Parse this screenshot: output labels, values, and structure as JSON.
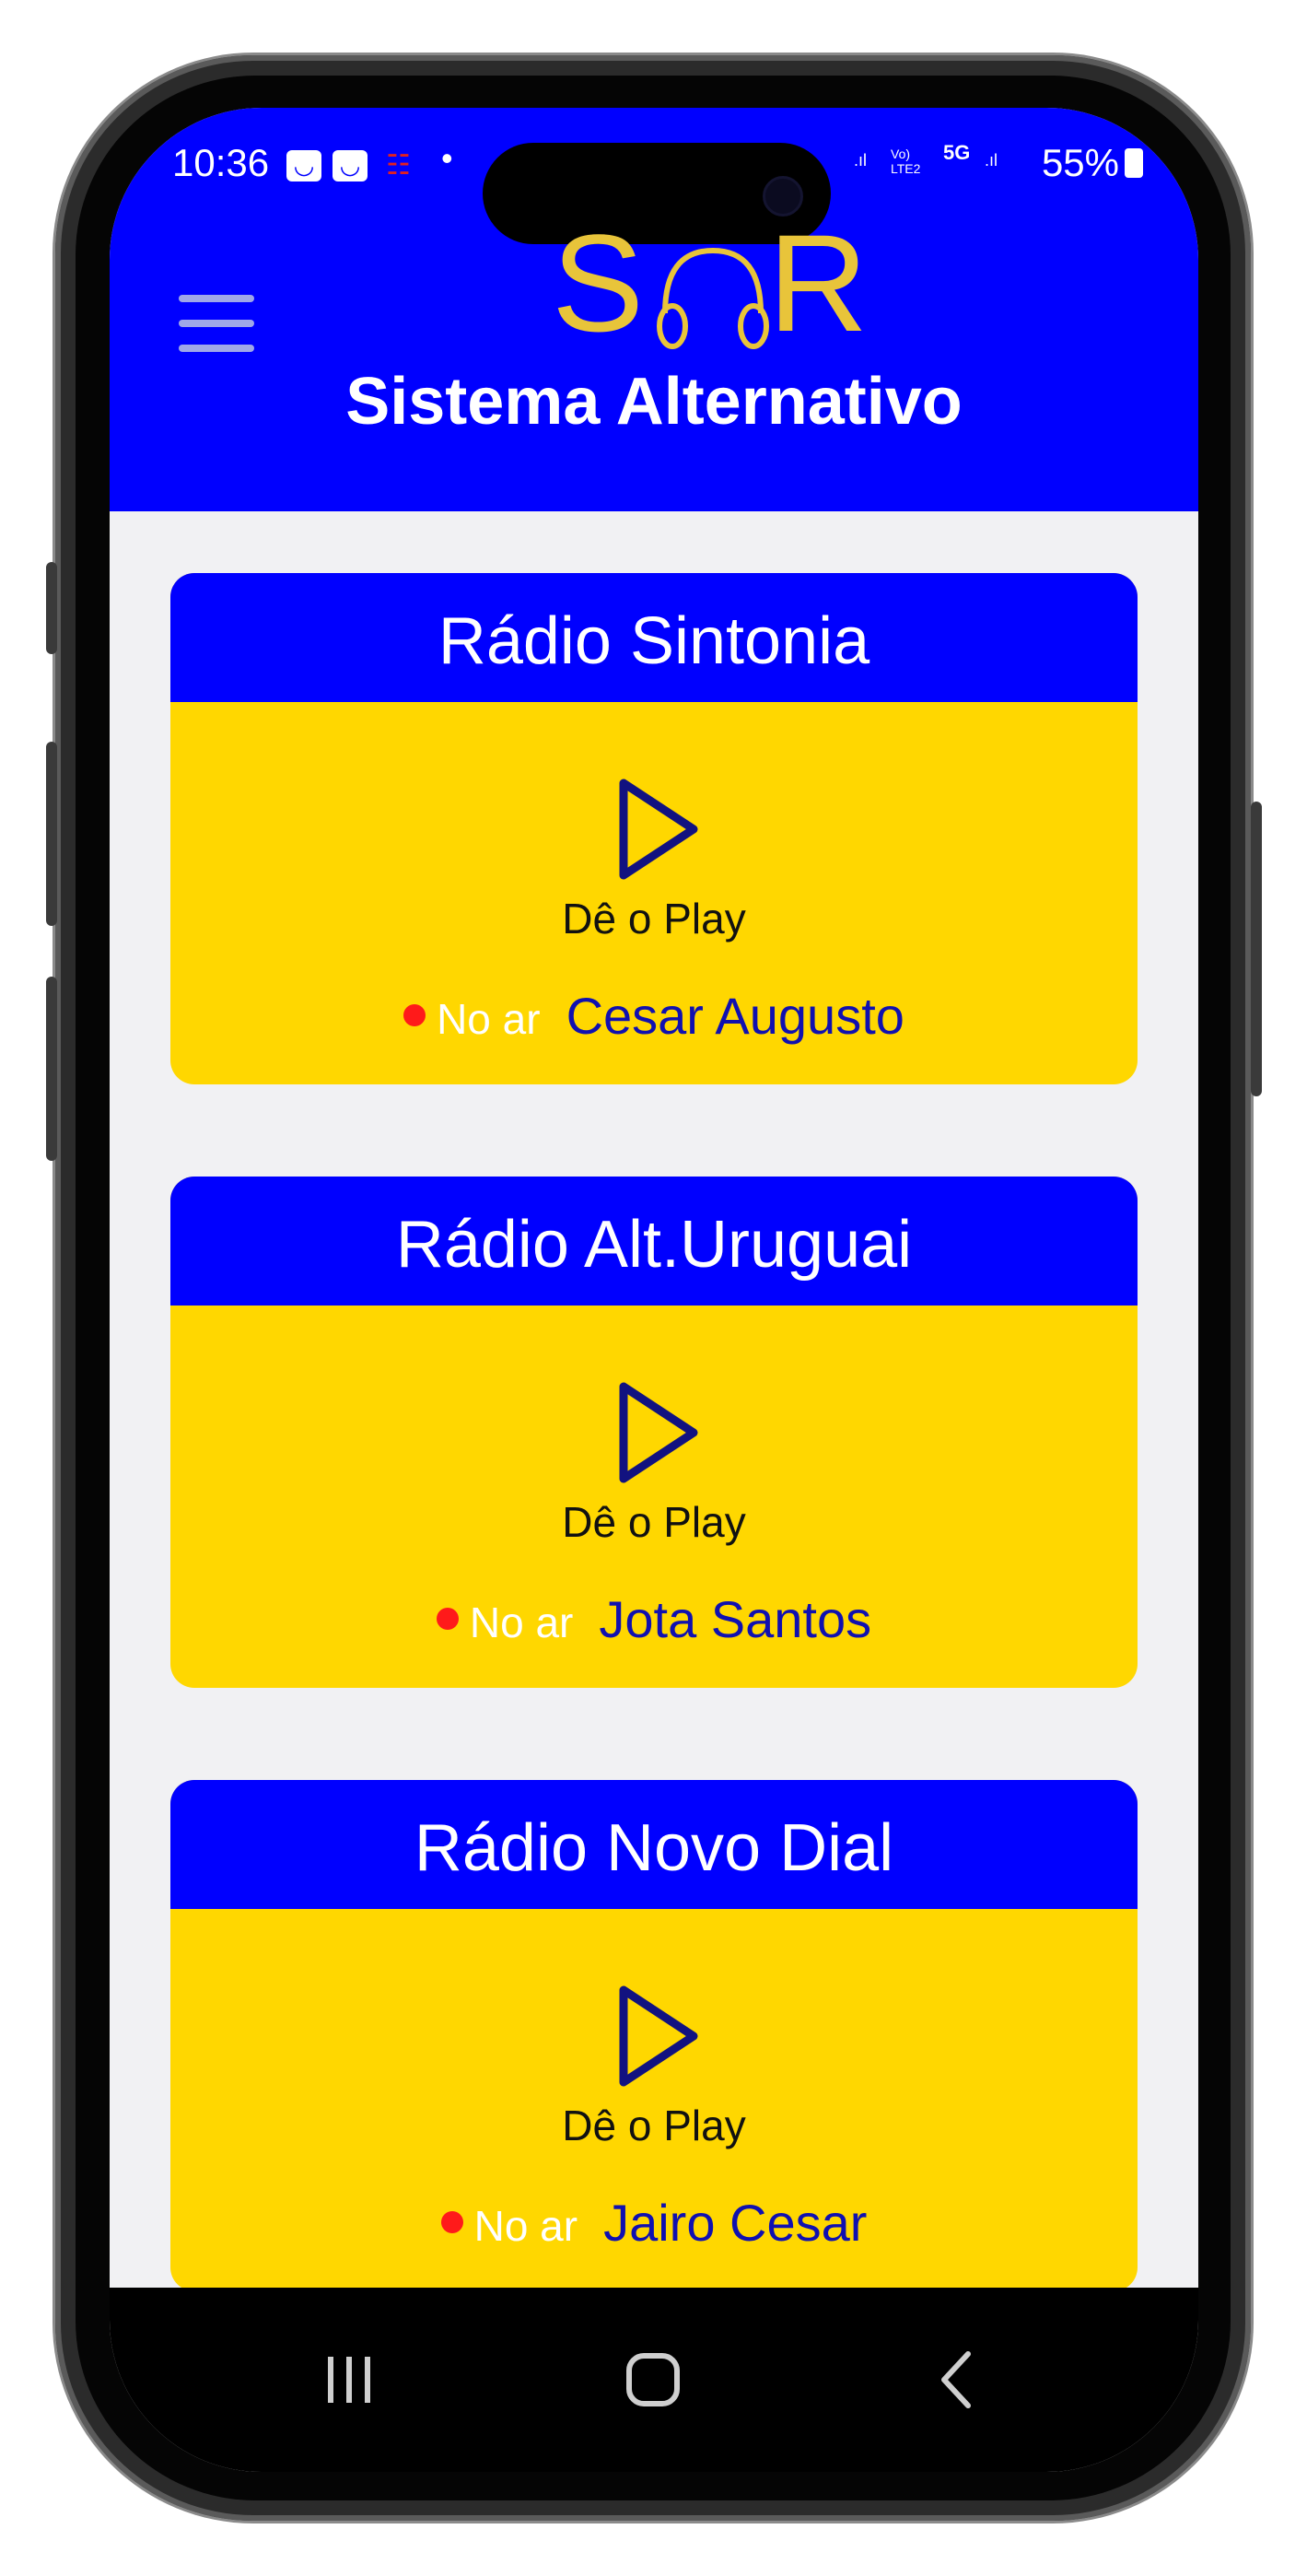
{
  "status_bar": {
    "time": "10:36",
    "battery": "55%",
    "network": "5G",
    "volte": "Vo) LTE2"
  },
  "header": {
    "logo_left": "S",
    "logo_right": "R",
    "app_title": "Sistema Alternativo",
    "accent": "#0000ff",
    "logo_color": "#e8c43a"
  },
  "stations": [
    {
      "name": "Rádio Sintonia",
      "play_label": "Dê o Play",
      "on_air_label": "No ar",
      "host": "Cesar Augusto"
    },
    {
      "name": "Rádio Alt.Uruguai",
      "play_label": "Dê o Play",
      "on_air_label": "No ar",
      "host": "Jota Santos"
    },
    {
      "name": "Rádio Novo Dial",
      "play_label": "Dê o Play",
      "on_air_label": "No ar",
      "host": "Jairo Cesar"
    }
  ],
  "nav_bar": {
    "icons": [
      "recent-apps-icon",
      "home-icon",
      "back-icon"
    ]
  },
  "colors": {
    "card_body": "#ffd700",
    "live_dot": "#ff1a1a",
    "host_text": "#1010b0"
  }
}
